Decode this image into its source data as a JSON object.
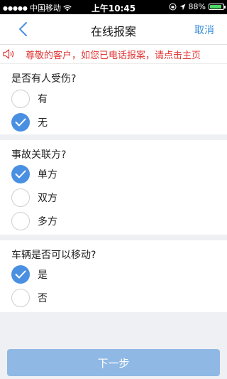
{
  "status_bar": {
    "carrier": "中国移动",
    "time": "上午10:45",
    "battery": "88%",
    "battery_level": 0.88
  },
  "nav": {
    "title": "在线报案",
    "cancel_label": "取消"
  },
  "notice": {
    "text": "尊敬的客户，如您已电话报案，请点击主页"
  },
  "questions": [
    {
      "question": "是否有人受伤?",
      "options": [
        {
          "label": "有",
          "checked": false
        },
        {
          "label": "无",
          "checked": true
        }
      ]
    },
    {
      "question": "事故关联方?",
      "options": [
        {
          "label": "单方",
          "checked": true
        },
        {
          "label": "双方",
          "checked": false
        },
        {
          "label": "多方",
          "checked": false
        }
      ]
    },
    {
      "question": "车辆是否可以移动?",
      "options": [
        {
          "label": "是",
          "checked": true
        },
        {
          "label": "否",
          "checked": false
        }
      ]
    }
  ],
  "footer": {
    "next_label": "下一步"
  },
  "colors": {
    "accent": "#4a90e2",
    "button": "#8fb8e4",
    "notice_text": "#e23636",
    "battery_fill": "#4cd964"
  }
}
